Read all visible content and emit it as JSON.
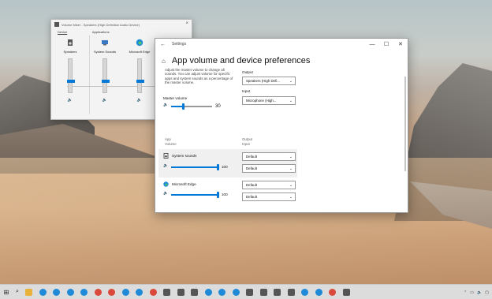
{
  "mixer": {
    "title": "Volume Mixer - Speakers (High Definition Audio Device)",
    "close": "×",
    "device_label": "Device",
    "apps_label": "Applications",
    "columns": [
      {
        "label": "Speakers",
        "icon": "speaker-device-icon",
        "level": 0.35
      },
      {
        "label": "System Sounds",
        "icon": "system-sounds-icon",
        "level": 0.35
      },
      {
        "label": "Microsoft Edge",
        "icon": "edge-icon",
        "level": 0.35
      }
    ]
  },
  "settings": {
    "title": "Settings",
    "back": "←",
    "minimize": "—",
    "maximize": "☐",
    "close": "✕",
    "page_title": "App volume and device preferences",
    "description": "Adjust the master volume to change all sounds. You can adjust volume for specific apps and system sounds as a percentage of the master volume.",
    "output_label": "Output",
    "output_value": "Speakers (High Defi...",
    "input_label": "Input",
    "input_value": "Microphone (High...",
    "master_label": "Master volume",
    "master_value": "30",
    "master_level": 0.3,
    "app_header": "App",
    "volume_header": "Volume",
    "output_header": "Output",
    "input_header": "Input",
    "apps": [
      {
        "name": "System sounds",
        "value": "100",
        "level": 1.0,
        "output": "Default",
        "input": "Default"
      },
      {
        "name": "Microsoft Edge",
        "value": "100",
        "level": 1.0,
        "output": "Default",
        "input": "Default"
      }
    ]
  },
  "colors": {
    "accent": "#0078d7"
  },
  "taskbar": {
    "apps": [
      "file-explorer",
      "edge",
      "edge",
      "edge",
      "edge",
      "chrome",
      "chrome",
      "edge",
      "edge",
      "chrome",
      "app",
      "app",
      "app",
      "edge",
      "edge",
      "edge",
      "app",
      "app",
      "app",
      "app",
      "edge",
      "edge",
      "chrome",
      "app"
    ]
  }
}
